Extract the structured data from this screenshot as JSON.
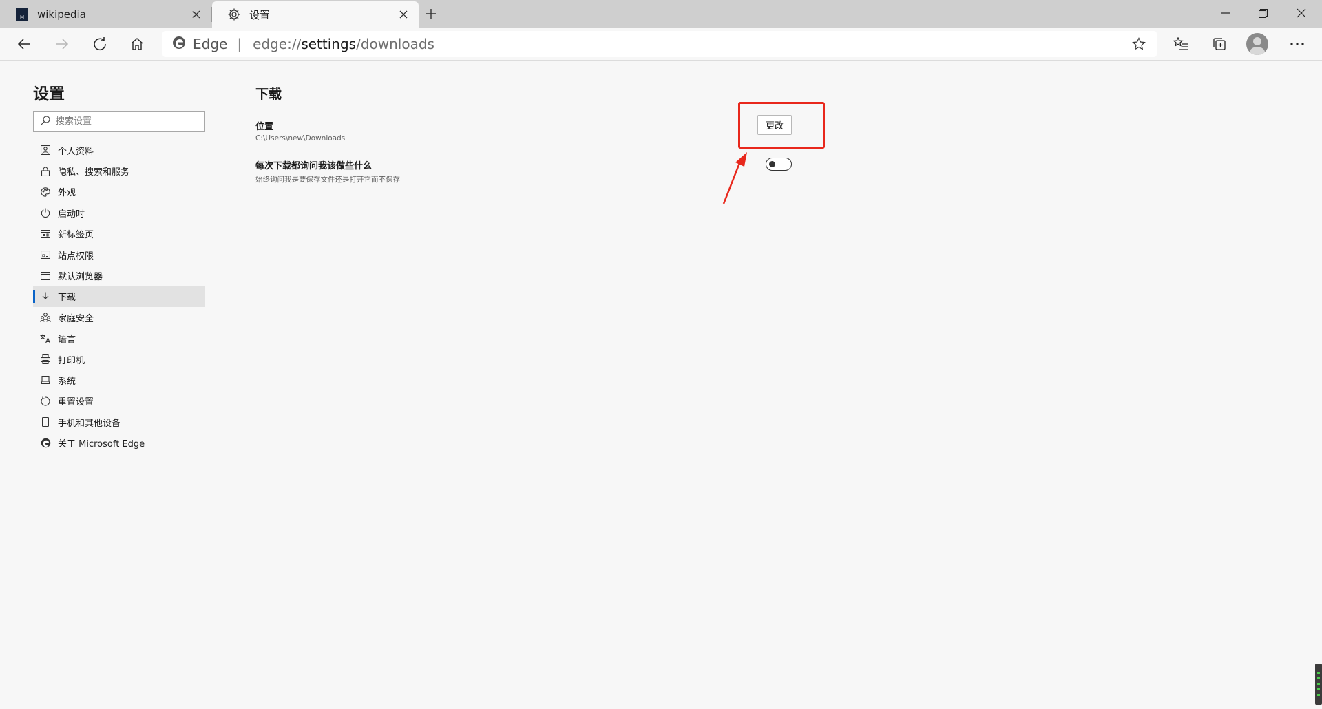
{
  "tabs": [
    {
      "title": "wikipedia",
      "favicon": "wikipedia-favicon",
      "active": false
    },
    {
      "title": "设置",
      "favicon": "gear-icon",
      "active": true
    }
  ],
  "toolbar": {
    "brand": "Edge",
    "separator": "|",
    "url_prefix": "edge://",
    "url_host": "settings",
    "url_path": "/downloads"
  },
  "sidebar": {
    "title": "设置",
    "search_placeholder": "搜索设置",
    "items": [
      {
        "label": "个人资料",
        "icon": "profile-icon"
      },
      {
        "label": "隐私、搜索和服务",
        "icon": "lock-icon"
      },
      {
        "label": "外观",
        "icon": "palette-icon"
      },
      {
        "label": "启动时",
        "icon": "power-icon"
      },
      {
        "label": "新标签页",
        "icon": "newtab-icon"
      },
      {
        "label": "站点权限",
        "icon": "site-permissions-icon"
      },
      {
        "label": "默认浏览器",
        "icon": "browser-icon"
      },
      {
        "label": "下载",
        "icon": "download-icon",
        "selected": true
      },
      {
        "label": "家庭安全",
        "icon": "family-icon"
      },
      {
        "label": "语言",
        "icon": "language-icon"
      },
      {
        "label": "打印机",
        "icon": "printer-icon"
      },
      {
        "label": "系统",
        "icon": "system-icon"
      },
      {
        "label": "重置设置",
        "icon": "reset-icon"
      },
      {
        "label": "手机和其他设备",
        "icon": "phone-icon"
      },
      {
        "label": "关于 Microsoft Edge",
        "icon": "edge-logo-icon"
      }
    ]
  },
  "main": {
    "title": "下载",
    "location_label": "位置",
    "location_path": "C:\\Users\\new\\Downloads",
    "change_button": "更改",
    "ask_label": "每次下载都询问我该做些什么",
    "ask_desc": "始终询问我是要保存文件还是打开它而不保存",
    "ask_enabled": false
  },
  "colors": {
    "accent": "#0a64c8",
    "annotation": "#e8281c",
    "tabstrip": "#cfcfcf",
    "background": "#f7f7f7"
  }
}
